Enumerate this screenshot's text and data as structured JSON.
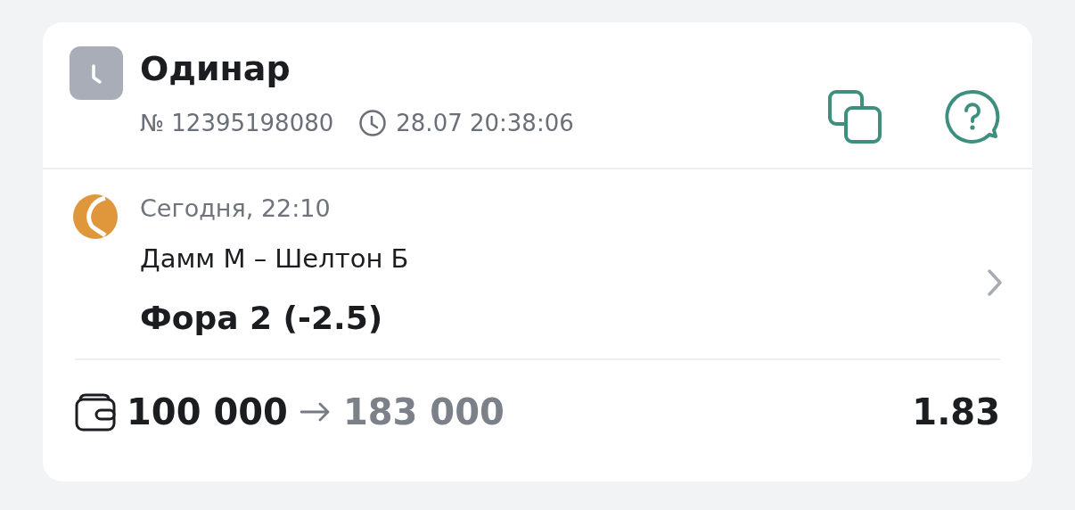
{
  "header": {
    "title": "Одинар",
    "number": "№ 12395198080",
    "datetime": "28.07 20:38:06"
  },
  "event": {
    "start": "Сегодня, 22:10",
    "match": "Дамм М – Шелтон Б",
    "bet": "Фора 2 (-2.5)"
  },
  "footer": {
    "stake": "100 000",
    "payout": "183 000",
    "odds": "1.83"
  }
}
